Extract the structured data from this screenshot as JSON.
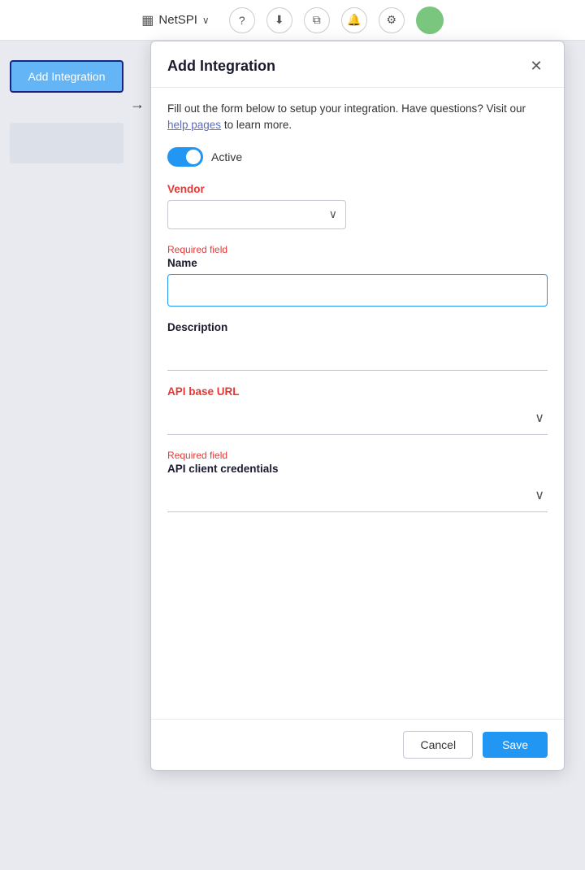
{
  "nav": {
    "brand": "NetSPI",
    "brand_icon": "▦",
    "chevron": "∨",
    "icons": [
      "?",
      "⬇",
      "⧉",
      "🔔",
      "⚙"
    ]
  },
  "sidebar": {
    "add_integration_label": "Add Integration"
  },
  "modal": {
    "title": "Add Integration",
    "close_icon": "✕",
    "description_part1": "Fill out the form below to setup your integration. Have questions? Visit our ",
    "help_link_text": "help pages",
    "description_part2": " to learn more.",
    "toggle_label": "Active",
    "toggle_active": true,
    "vendor_label": "Vendor",
    "required_field_text": "Required field",
    "name_label": "Name",
    "name_placeholder": "",
    "description_label": "Description",
    "api_url_label": "API base URL",
    "api_credentials_required": "Required field",
    "api_credentials_label": "API client credentials",
    "cancel_label": "Cancel",
    "save_label": "Save"
  }
}
